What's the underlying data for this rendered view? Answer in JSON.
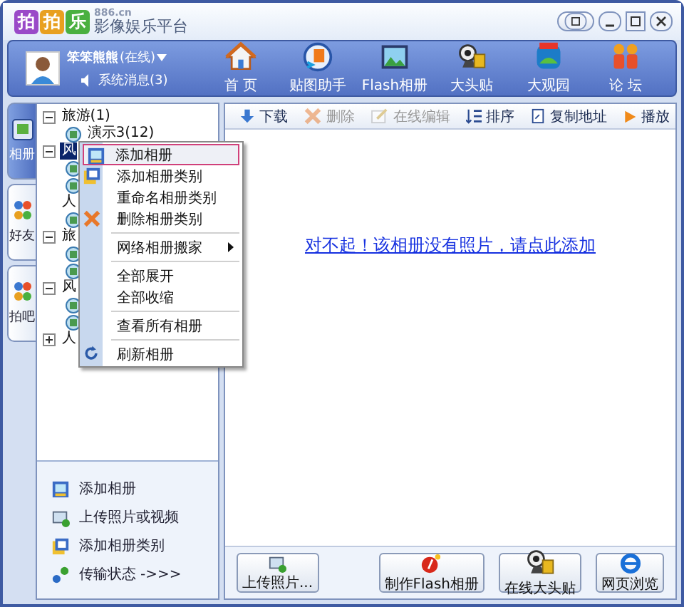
{
  "app": {
    "logo": [
      "拍",
      "拍",
      "乐"
    ],
    "domain": "886.cn",
    "title": "影像娱乐平台"
  },
  "user": {
    "name": "笨笨熊熊",
    "status": "(在线)",
    "messages": "系统消息(3)"
  },
  "nav": [
    {
      "label": "首 页"
    },
    {
      "label": "贴图助手"
    },
    {
      "label": "Flash相册"
    },
    {
      "label": "大头贴"
    },
    {
      "label": "大观园"
    },
    {
      "label": "论 坛"
    }
  ],
  "side_tabs": [
    {
      "label": "相册",
      "selected": true
    },
    {
      "label": "好友",
      "selected": false
    },
    {
      "label": "拍吧",
      "selected": false
    }
  ],
  "tree": [
    {
      "label": "旅游(1)",
      "expanded": true,
      "selected": false,
      "children": [
        {
          "kind": "album",
          "label": "演示3(12)"
        }
      ]
    },
    {
      "label": "风",
      "expanded": true,
      "selected": true,
      "children": [
        {
          "kind": "album"
        },
        {
          "kind": "album"
        }
      ]
    },
    {
      "label": "人",
      "selected": false,
      "children": [
        {
          "kind": "album"
        }
      ]
    },
    {
      "label": "旅",
      "expanded": true,
      "selected": false,
      "children": [
        {
          "kind": "album"
        },
        {
          "kind": "album"
        }
      ]
    },
    {
      "label": "风",
      "expanded": true,
      "selected": false,
      "children": [
        {
          "kind": "album"
        },
        {
          "kind": "album"
        }
      ]
    },
    {
      "label": "人",
      "expanded": false,
      "selected": false
    }
  ],
  "context_menu": [
    {
      "kind": "item",
      "label": "添加相册",
      "selected": true
    },
    {
      "kind": "item",
      "label": "添加相册类别",
      "selected": false
    },
    {
      "kind": "item",
      "label": "重命名相册类别",
      "selected": false
    },
    {
      "kind": "item",
      "label": "删除相册类别",
      "selected": false
    },
    {
      "kind": "separator"
    },
    {
      "kind": "submenu",
      "label": "网络相册搬家",
      "selected": false
    },
    {
      "kind": "separator"
    },
    {
      "kind": "item",
      "label": "全部展开",
      "selected": false
    },
    {
      "kind": "item",
      "label": "全部收缩",
      "selected": false
    },
    {
      "kind": "separator"
    },
    {
      "kind": "item",
      "label": "查看所有相册",
      "selected": false
    },
    {
      "kind": "separator"
    },
    {
      "kind": "item",
      "label": "刷新相册",
      "selected": false
    }
  ],
  "left_actions": [
    {
      "label": "添加相册"
    },
    {
      "label": "上传照片或视频"
    },
    {
      "label": "添加相册类别"
    },
    {
      "label": "传输状态 ->>>"
    }
  ],
  "toolbar": [
    {
      "label": "下载",
      "disabled": false
    },
    {
      "label": "删除",
      "disabled": true
    },
    {
      "label": "在线编辑",
      "disabled": true
    },
    {
      "label": "排序",
      "disabled": false
    },
    {
      "label": "复制地址",
      "disabled": false
    },
    {
      "label": "播放",
      "disabled": false
    }
  ],
  "empty_message": "对不起！该相册没有照片，请点此添加",
  "bottom_buttons": [
    {
      "label": "上传照片..."
    },
    {
      "label": "制作Flash相册"
    },
    {
      "label": "在线大头贴"
    },
    {
      "label": "网页浏览"
    }
  ]
}
